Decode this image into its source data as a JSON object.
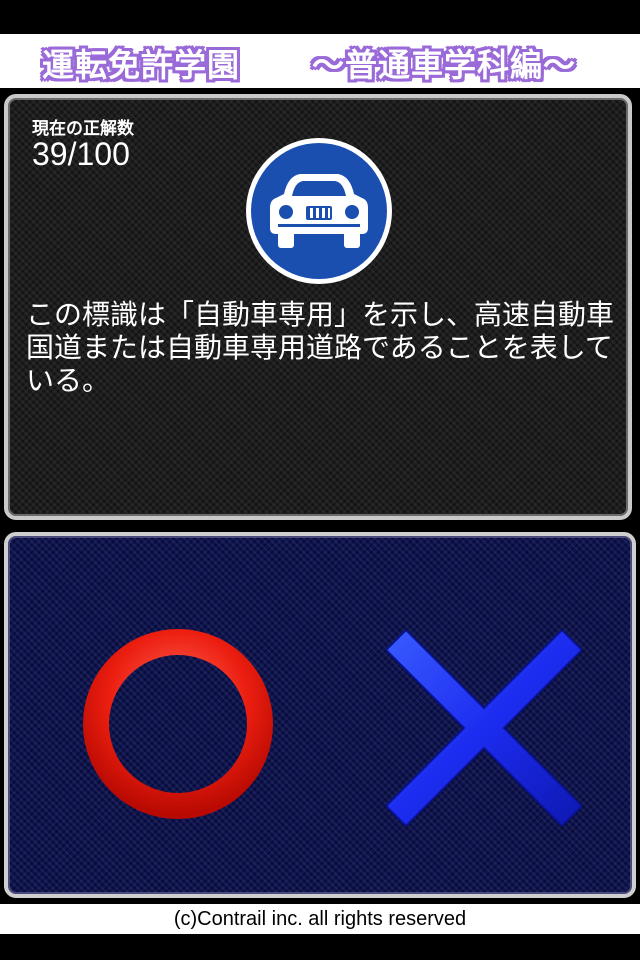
{
  "header": {
    "title": "運転免許学園",
    "subtitle": "〜普通車学科編〜",
    "title_color": "#9a6ad8"
  },
  "question": {
    "score_label": "現在の正解数",
    "score_value": "39/100",
    "sign_icon": "car-only-road-sign-icon",
    "sign_color": "#1a4fb0",
    "explanation": "この標識は「自動車専用」を示し、高速自動車国道または自動車専用道路であることを表している。"
  },
  "answers": {
    "correct_icon": "circle-maru-icon",
    "correct_color": "#e81c10",
    "wrong_icon": "cross-batsu-icon",
    "wrong_color": "#1c2cf0"
  },
  "footer": {
    "copyright": "(c)Contrail inc. all rights reserved"
  }
}
